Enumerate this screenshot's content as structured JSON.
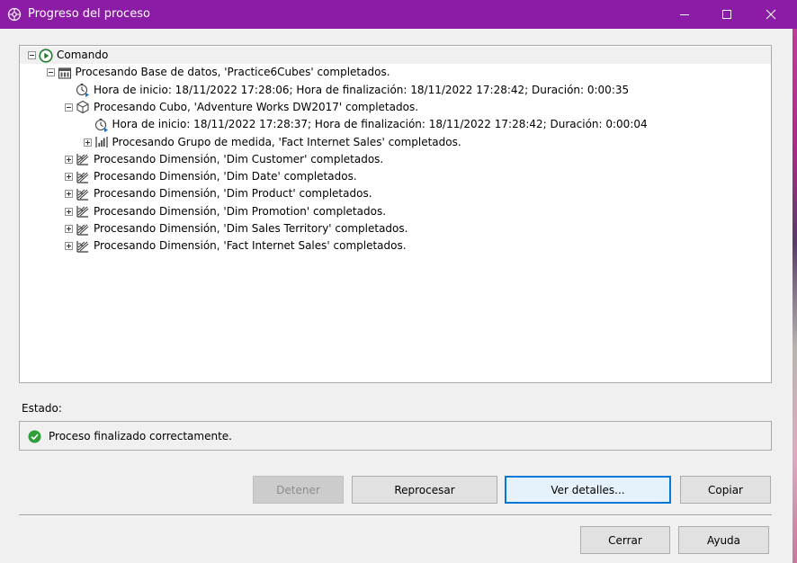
{
  "window": {
    "title": "Progreso del proceso"
  },
  "colors": {
    "titlebar": "#8c1ba5",
    "success": "#2e9f3a",
    "focus": "#0078d7"
  },
  "tree": {
    "rows": [
      {
        "label": "Comando",
        "icon": "play-icon",
        "expander": "minus",
        "level": 0,
        "selected": true
      },
      {
        "label": "Procesando Base de datos, 'Practice6Cubes' completados.",
        "icon": "database-icon",
        "expander": "minus",
        "level": 1
      },
      {
        "label": "Hora de inicio: 18/11/2022 17:28:06; Hora de finalización: 18/11/2022 17:28:42; Duración: 0:00:35",
        "icon": "timer-icon",
        "expander": "none",
        "level": 2
      },
      {
        "label": "Procesando Cubo, 'Adventure Works DW2017' completados.",
        "icon": "cube-icon",
        "expander": "minus",
        "level": 2
      },
      {
        "label": "Hora de inicio: 18/11/2022 17:28:37; Hora de finalización: 18/11/2022 17:28:42; Duración: 0:00:04",
        "icon": "timer-icon",
        "expander": "none",
        "level": 3
      },
      {
        "label": "Procesando Grupo de medida, 'Fact Internet Sales' completados.",
        "icon": "measure-group-icon",
        "expander": "plus",
        "level": 3
      },
      {
        "label": "Procesando Dimensión, 'Dim Customer' completados.",
        "icon": "dimension-icon",
        "expander": "plus",
        "level": 2
      },
      {
        "label": "Procesando Dimensión, 'Dim Date' completados.",
        "icon": "dimension-icon",
        "expander": "plus",
        "level": 2
      },
      {
        "label": "Procesando Dimensión, 'Dim Product' completados.",
        "icon": "dimension-icon",
        "expander": "plus",
        "level": 2
      },
      {
        "label": "Procesando Dimensión, 'Dim Promotion' completados.",
        "icon": "dimension-icon",
        "expander": "plus",
        "level": 2
      },
      {
        "label": "Procesando Dimensión, 'Dim Sales Territory' completados.",
        "icon": "dimension-icon",
        "expander": "plus",
        "level": 2
      },
      {
        "label": "Procesando Dimensión, 'Fact Internet Sales' completados.",
        "icon": "dimension-icon",
        "expander": "plus",
        "level": 2
      }
    ]
  },
  "status": {
    "label": "Estado:",
    "message": "Proceso finalizado correctamente.",
    "icon": "check-circle-icon"
  },
  "buttons": {
    "stop": "Detener",
    "reprocess": "Reprocesar",
    "details": "Ver detalles...",
    "copy": "Copiar",
    "close": "Cerrar",
    "help": "Ayuda"
  }
}
